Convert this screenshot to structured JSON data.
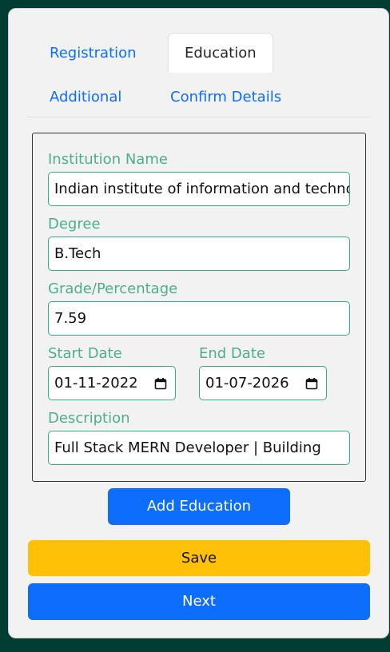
{
  "tabs": {
    "registration": "Registration",
    "education": "Education",
    "additional": "Additional",
    "confirm": "Confirm Details"
  },
  "form": {
    "institution": {
      "label": "Institution Name",
      "value": "Indian institute of information and technology"
    },
    "degree": {
      "label": "Degree",
      "value": "B.Tech"
    },
    "grade": {
      "label": "Grade/Percentage",
      "value": "7.59"
    },
    "start_date": {
      "label": "Start Date",
      "value": "01-11-2022"
    },
    "end_date": {
      "label": "End Date",
      "value": "01-07-2026"
    },
    "description": {
      "label": "Description",
      "value": "Full Stack MERN Developer | Building"
    }
  },
  "buttons": {
    "add_education": "Add Education",
    "save": "Save",
    "next": "Next"
  },
  "colors": {
    "background": "#013d33",
    "accent_blue": "#0d6efd",
    "save_yellow": "#ffc107",
    "label_green": "#4caf8c"
  },
  "icons": {
    "calendar": "calendar-icon"
  }
}
